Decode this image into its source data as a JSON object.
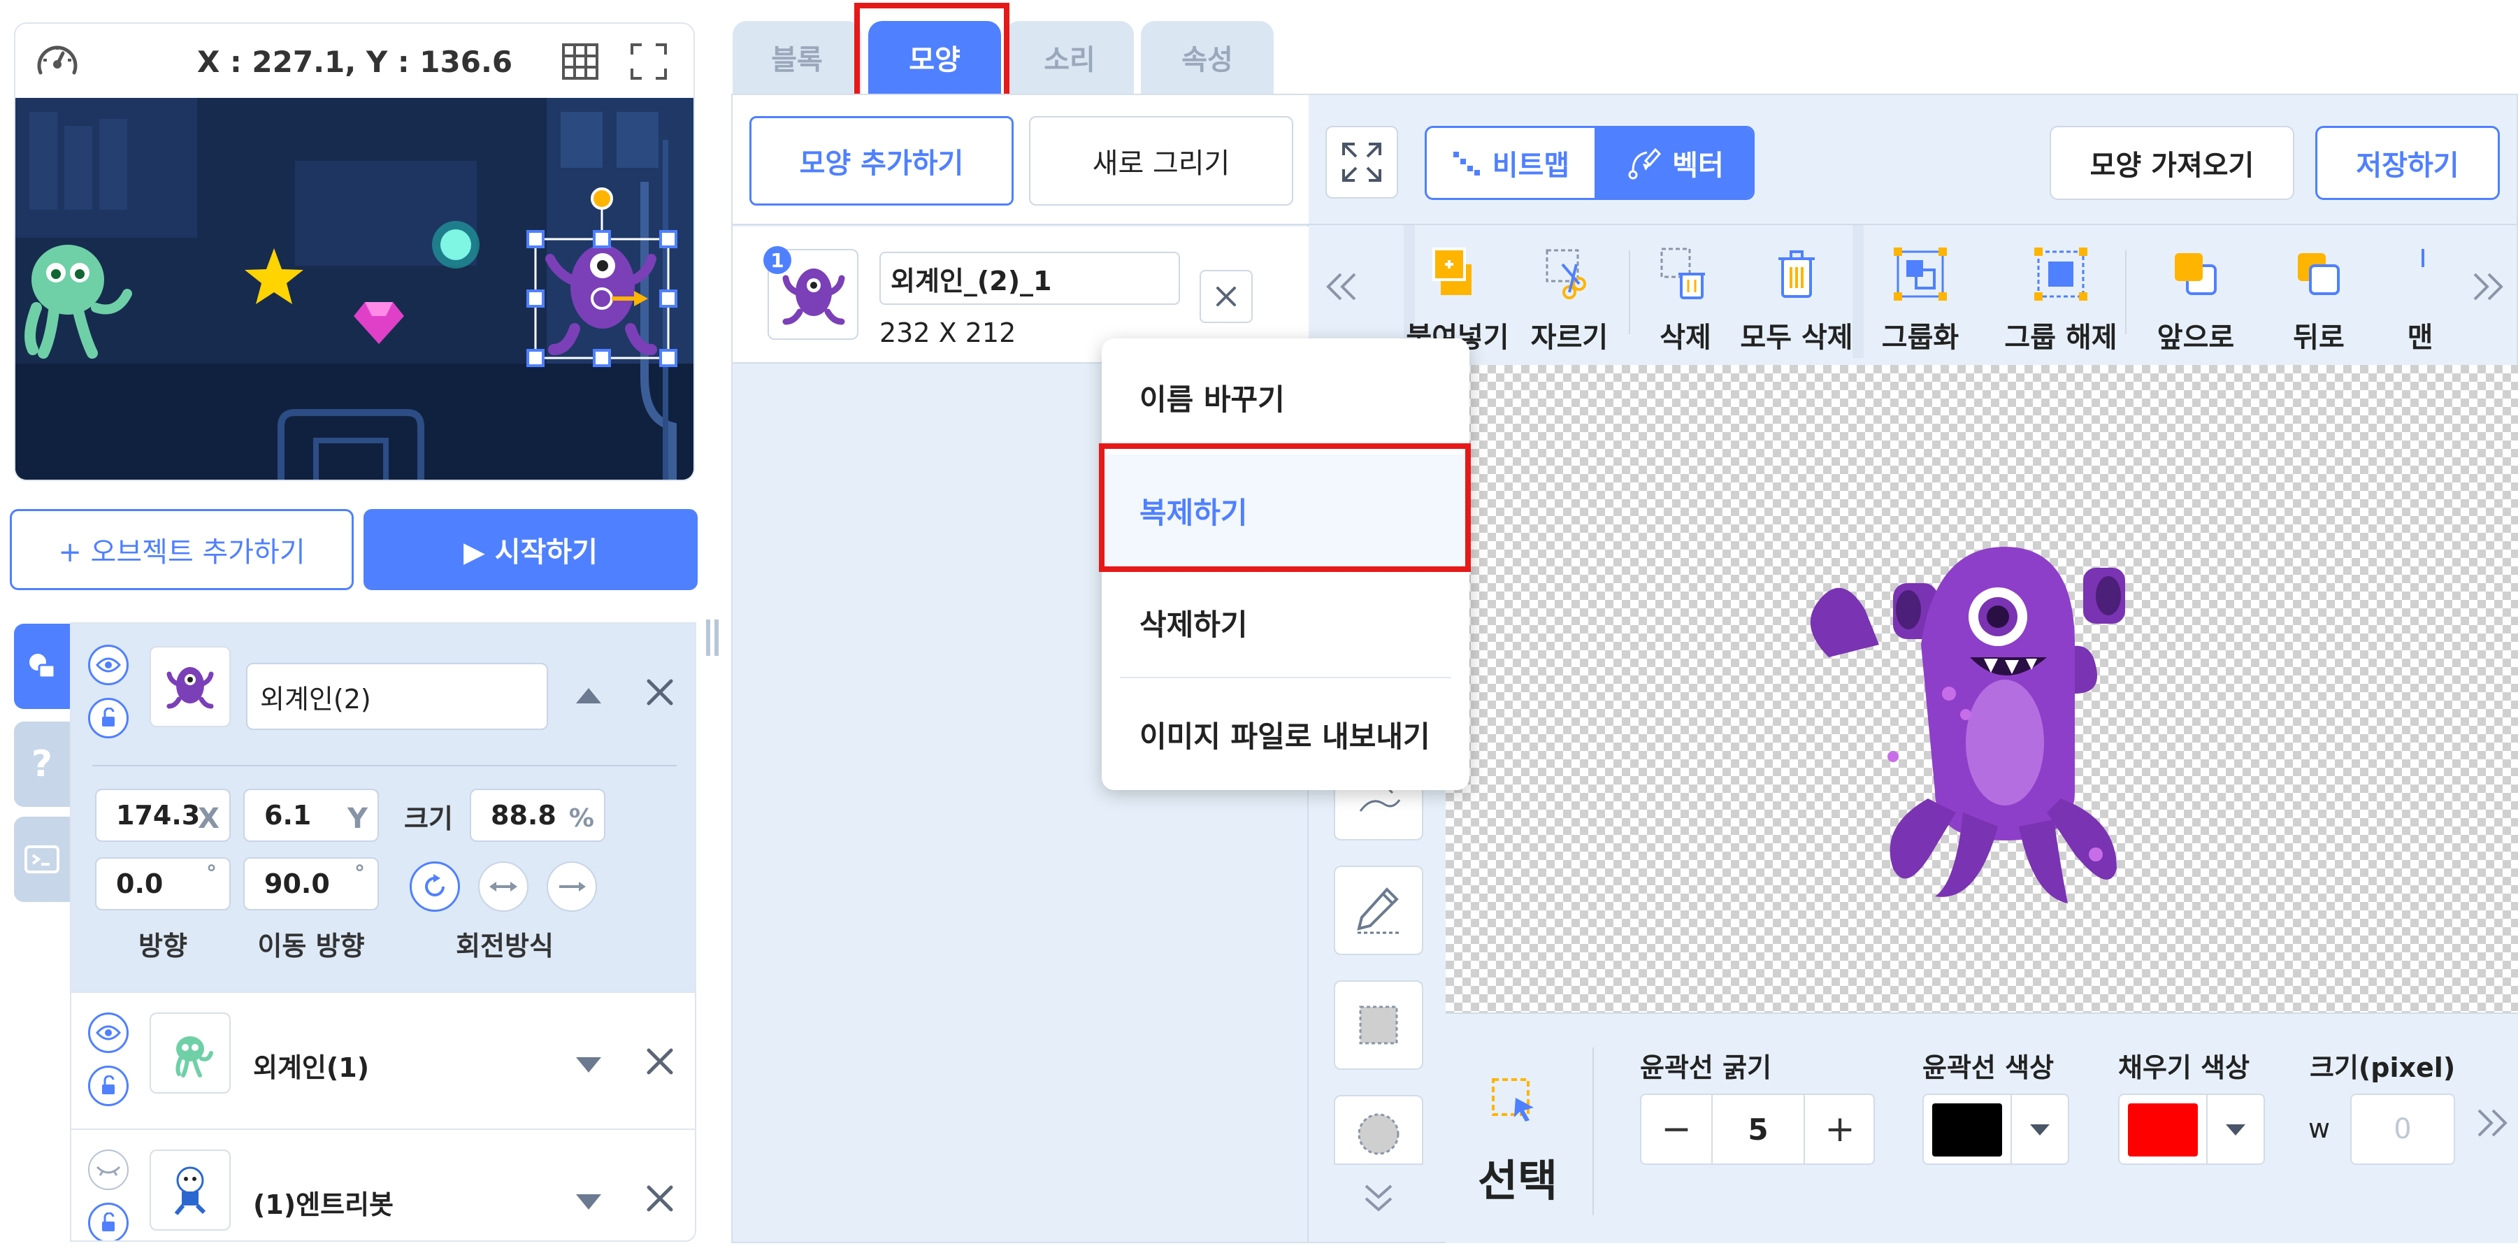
{
  "stage": {
    "coords": "X : 227.1, Y : 136.6",
    "add_object_label": "+ 오브젝트 추가하기",
    "start_label": "▶ 시작하기"
  },
  "object_panel": {
    "selected": {
      "name": "외계인(2)",
      "x": "174.3",
      "x_unit": "X",
      "y": "6.1",
      "y_unit": "Y",
      "size_label": "크기",
      "size": "88.8",
      "size_unit": "%",
      "direction": "0.0",
      "move_direction": "90.0",
      "degree": "°",
      "direction_label": "방향",
      "move_direction_label": "이동 방향",
      "rotation_label": "회전방식"
    },
    "others": [
      {
        "name": "외계인(1)"
      },
      {
        "name": "(1)엔트리봇"
      }
    ]
  },
  "tabs": [
    {
      "label": "블록"
    },
    {
      "label": "모양"
    },
    {
      "label": "소리"
    },
    {
      "label": "속성"
    }
  ],
  "shape_panel": {
    "add_shape_label": "모양 추가하기",
    "new_draw_label": "새로 그리기",
    "item": {
      "index": "1",
      "name": "외계인_(2)_1",
      "dimensions": "232 X 212"
    }
  },
  "editor": {
    "bitmap_label": "비트맵",
    "vector_label": "벡터",
    "import_label": "모양 가져오기",
    "save_label": "저장하기",
    "tools": [
      {
        "label": "붙여넣기"
      },
      {
        "label": "자르기"
      },
      {
        "label": "삭제"
      },
      {
        "label": "모두 삭제"
      },
      {
        "label": "그룹화"
      },
      {
        "label": "그룹 해제"
      },
      {
        "label": "앞으로"
      },
      {
        "label": "뒤로"
      },
      {
        "label": "맨"
      }
    ],
    "select_label": "선택",
    "stroke_width_label": "윤곽선 굵기",
    "stroke_width_value": "5",
    "stroke_color_label": "윤곽선 색상",
    "fill_color_label": "채우기 색상",
    "size_label": "크기(pixel)",
    "w_label": "w",
    "w_value": "0",
    "stroke_color": "#000000",
    "fill_color": "#ff0000"
  },
  "context_menu": {
    "items": [
      {
        "label": "이름 바꾸기"
      },
      {
        "label": "복제하기"
      },
      {
        "label": "삭제하기"
      },
      {
        "label": "이미지 파일로 내보내기"
      }
    ]
  },
  "colors": {
    "accent": "#4f80ff",
    "highlight_red": "#e61919",
    "panel_bg": "#e7f0fa",
    "stage_bg": "#172b4f"
  }
}
